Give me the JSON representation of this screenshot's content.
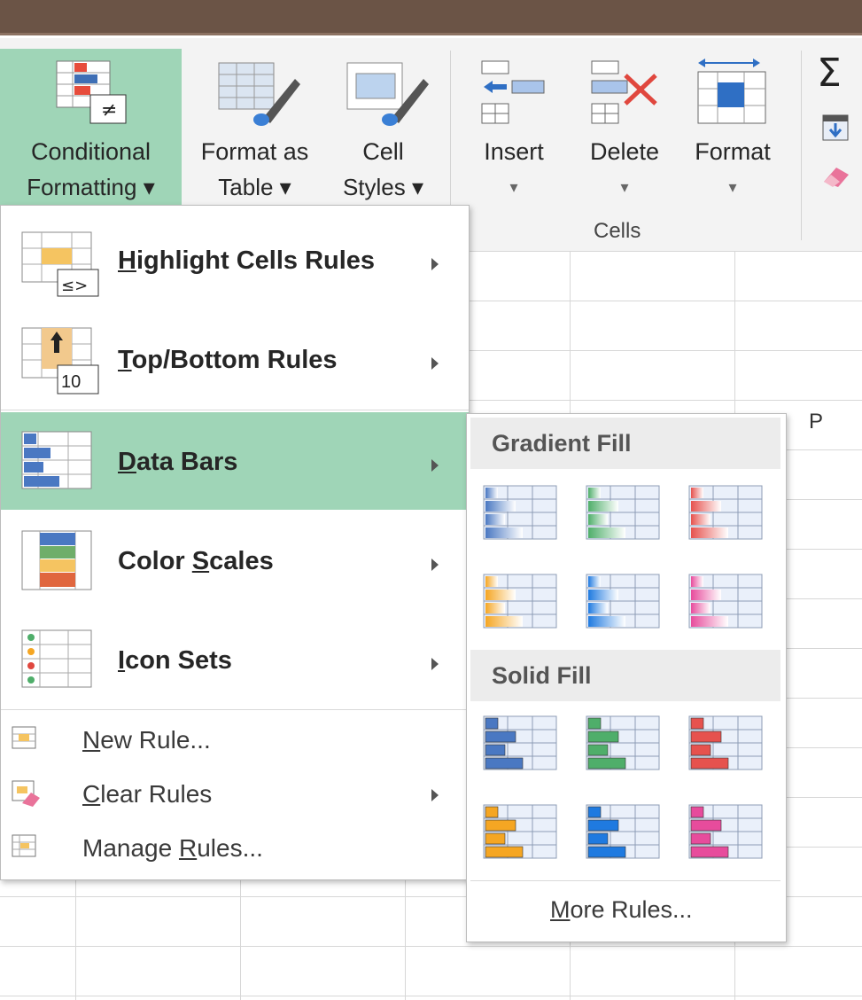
{
  "ribbon": {
    "conditional_formatting": {
      "line1": "Conditional",
      "line2": "Formatting ▾"
    },
    "format_as_table": {
      "line1": "Format as",
      "line2": "Table ▾"
    },
    "cell_styles": {
      "line1": "Cell",
      "line2": "Styles ▾"
    },
    "insert": {
      "line1": "Insert",
      "line2": "▾"
    },
    "delete": {
      "line1": "Delete",
      "line2": "▾"
    },
    "format": {
      "line1": "Format",
      "line2": "▾"
    },
    "cells_group_label": "Cells",
    "sum_glyph": "Σ"
  },
  "sheet": {
    "column_header_p": "P"
  },
  "menu": {
    "highlight": {
      "pre": "",
      "key": "H",
      "post": "ighlight Cells Rules"
    },
    "top_bottom": {
      "pre": "",
      "key": "T",
      "post": "op/Bottom Rules"
    },
    "data_bars": {
      "pre": "",
      "key": "D",
      "post": "ata Bars"
    },
    "color_scales": {
      "pre": "Color ",
      "key": "S",
      "post": "cales"
    },
    "icon_sets": {
      "pre": "",
      "key": "I",
      "post": "con Sets"
    },
    "new_rule": {
      "pre": "",
      "key": "N",
      "post": "ew Rule..."
    },
    "clear_rules": {
      "pre": "",
      "key": "C",
      "post": "lear Rules"
    },
    "manage_rules": {
      "pre": "Manage ",
      "key": "R",
      "post": "ules..."
    },
    "top_bottom_badge": "10"
  },
  "submenu": {
    "gradient_fill": "Gradient Fill",
    "solid_fill": "Solid Fill",
    "more_rules": {
      "pre": "",
      "key": "M",
      "post": "ore Rules..."
    }
  },
  "colors": {
    "accent_green": "#9fd5b7",
    "bar_blue": "#4a78c2",
    "bar_green": "#4fae6a",
    "bar_red": "#e6524e",
    "bar_orange": "#f5a623",
    "bar_lightblue": "#1f7ae0",
    "bar_pink": "#e74c9c"
  }
}
